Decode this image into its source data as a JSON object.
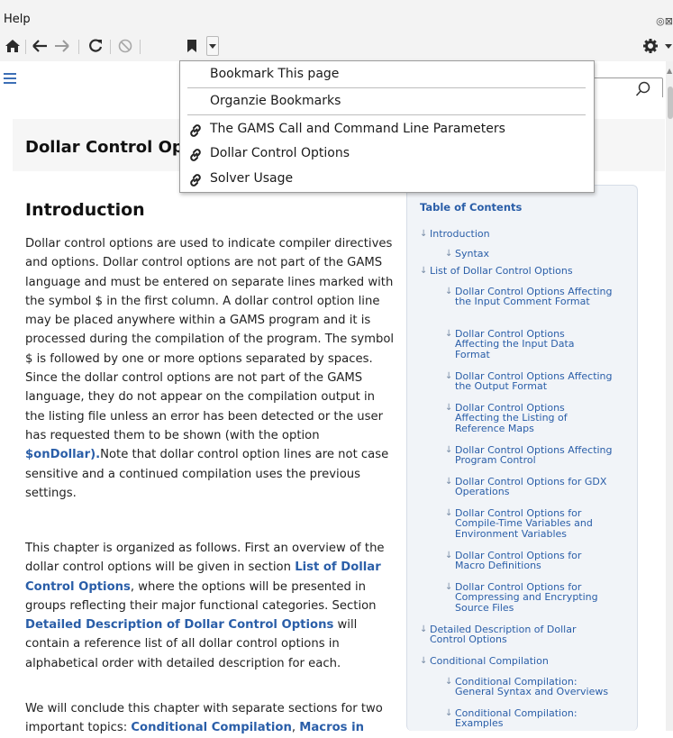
{
  "window": {
    "title": "Help",
    "controls": "◎⊠"
  },
  "toolbar": {
    "home": "home-icon",
    "back": "back-arrow-icon",
    "forward": "forward-arrow-icon",
    "reload": "reload-icon",
    "stop": "stop-icon",
    "bookmark": "bookmark-icon",
    "settings": "gear-icon"
  },
  "bookmark_menu": {
    "items": [
      {
        "label": "Bookmark This page"
      },
      {
        "label": "Organzie Bookmarks"
      },
      {
        "label": "The GAMS Call and Command Line Parameters"
      },
      {
        "label": "Dollar Control Options"
      },
      {
        "label": "Solver Usage"
      }
    ]
  },
  "page": {
    "title": "Dollar Control Options",
    "intro_heading": "Introduction",
    "p1": {
      "before": "Dollar control options are used to indicate compiler directives and options. Dollar control options are not part of the GAMS language and must be entered on separate lines marked with the symbol $ in the first column. A dollar control option line may be placed anywhere within a GAMS program and it is processed during the compilation of the program. The symbol $ is followed by one or more options separated by spaces. Since the dollar control options are not part of the GAMS language, they do not appear on the compilation output in the listing file unless an error has been detected or the user has requested them to be shown (with the option ",
      "link": "$onDollar).",
      "after": "Note that dollar control option lines are not case sensitive and a continued compilation uses the previous settings."
    },
    "p2": {
      "t1": "This chapter is organized as follows. First an overview of the dollar control options will be given in section ",
      "link1": "List of Dollar Control Options",
      "t2": ", where the options will be presented in groups reflecting their major functional categories. Section ",
      "link2": "Detailed Description of Dollar Control Options",
      "t3": " will contain a reference list of all dollar control options in alphabetical order with detailed description for each."
    },
    "p3": {
      "t1": "We will conclude this chapter with separate sections for two important topics: ",
      "link1": "Conditional Compilation",
      "t2": ", ",
      "link2": "Macros in"
    }
  },
  "toc": {
    "title": "Table of Contents",
    "items": [
      {
        "label": "Introduction"
      },
      {
        "label": "Syntax"
      },
      {
        "label": "List of Dollar Control Options"
      },
      {
        "label": "Dollar Control Options Affecting the Input Comment Format"
      },
      {
        "label": "Dollar Control Options Affecting the Input Data Format"
      },
      {
        "label": "Dollar Control Options Affecting the Output Format"
      },
      {
        "label": "Dollar Control Options Affecting the Listing of Reference Maps"
      },
      {
        "label": "Dollar Control Options Affecting Program Control"
      },
      {
        "label": "Dollar Control Options for GDX Operations"
      },
      {
        "label": "Dollar Control Options for Compile-Time Variables and Environment Variables"
      },
      {
        "label": "Dollar Control Options for Macro Definitions"
      },
      {
        "label": "Dollar Control Options for Compressing and Encrypting Source Files"
      },
      {
        "label": "Detailed Description of Dollar Control Options"
      },
      {
        "label": "Conditional Compilation"
      },
      {
        "label": "Conditional Compilation: General Syntax and Overviews"
      },
      {
        "label": "Conditional Compilation: Examples"
      }
    ]
  }
}
